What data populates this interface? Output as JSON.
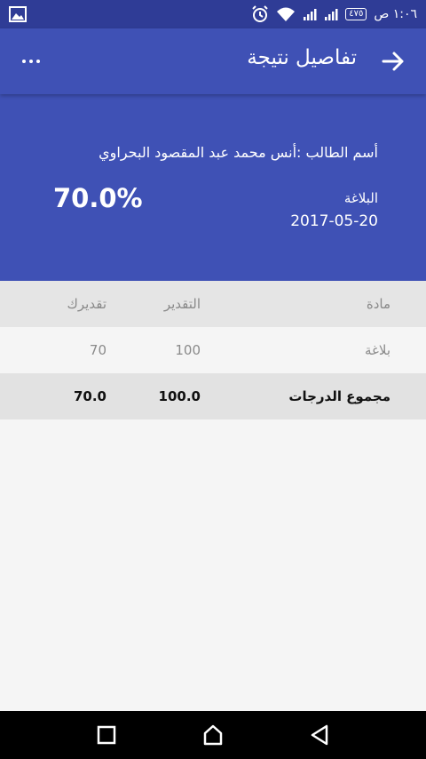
{
  "status_bar": {
    "time": "١:٠٦ ص",
    "battery": "٤٧٥",
    "icons": [
      "gallery-icon",
      "alarm-icon",
      "wifi-icon",
      "signal-icon",
      "signal-icon",
      "battery-icon"
    ]
  },
  "app_bar": {
    "title": "تفاصيل نتيجة",
    "back_icon": "arrow-right-icon",
    "more_icon": "more-horizontal-icon"
  },
  "result": {
    "student": "أسم الطالب :أنس محمد عبد المقصود البحراوي",
    "subject": "البلاغة",
    "date": "2017-05-20",
    "percent": "70.0%"
  },
  "table": {
    "headers": {
      "subject": "مادة",
      "grade": "التقدير",
      "score": "تقديرك"
    },
    "rows": [
      {
        "subject": "بلاغة",
        "grade": "100",
        "score": "70"
      }
    ],
    "total": {
      "label": "مجموع الدرجات",
      "grade": "100.0",
      "score": "70.0"
    }
  },
  "nav_bar": {
    "icons": [
      "recents-square-icon",
      "home-icon",
      "back-triangle-icon"
    ]
  },
  "colors": {
    "primary": "#3f51b5",
    "status_bar": "#2f3c96",
    "row_header": "#e5e5e5",
    "row_total": "#e2e2e2",
    "background": "#f5f5f5"
  }
}
